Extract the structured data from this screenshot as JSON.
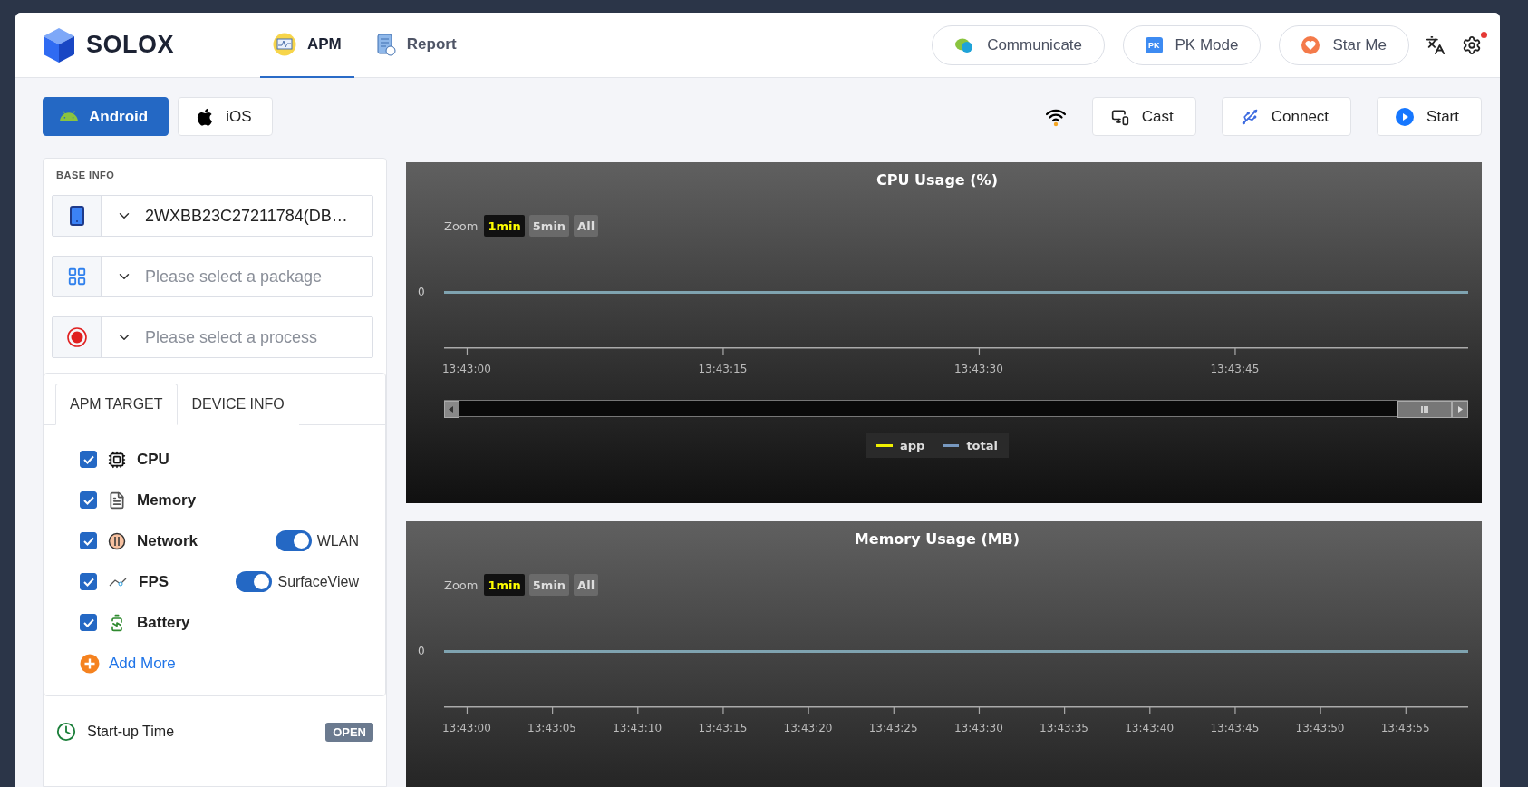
{
  "header": {
    "logo": "SOLOX",
    "tabs": [
      {
        "label": "APM",
        "selected": true
      },
      {
        "label": "Report",
        "selected": false
      }
    ],
    "actions": [
      {
        "label": "Communicate"
      },
      {
        "label": "PK Mode",
        "icon_text": "PK"
      },
      {
        "label": "Star Me"
      }
    ],
    "settings_badge": true
  },
  "platforms": [
    {
      "label": "Android",
      "selected": true
    },
    {
      "label": "iOS",
      "selected": false
    }
  ],
  "toolbar": [
    "Cast",
    "Connect",
    "Start"
  ],
  "base_info": {
    "title": "BASE INFO",
    "selects": [
      {
        "value": "2WXBB23C27211784(DB…"
      },
      {
        "placeholder": "Please select a package"
      },
      {
        "placeholder": "Please select a process"
      }
    ]
  },
  "target_tabs": [
    {
      "label": "APM TARGET",
      "selected": true
    },
    {
      "label": "DEVICE INFO",
      "selected": false
    }
  ],
  "targets": [
    {
      "label": "CPU",
      "checked": true
    },
    {
      "label": "Memory",
      "checked": true
    },
    {
      "label": "Network",
      "checked": true,
      "toggle": {
        "label": "WLAN",
        "on": true
      }
    },
    {
      "label": "FPS",
      "checked": true,
      "toggle": {
        "label": "SurfaceView",
        "on": true
      }
    },
    {
      "label": "Battery",
      "checked": true
    }
  ],
  "add_more": "Add More",
  "startup": {
    "label": "Start-up Time",
    "badge": "OPEN"
  },
  "charts": [
    {
      "title": "CPU Usage (%)",
      "zoom_label": "Zoom",
      "zoom_options": [
        {
          "label": "1min",
          "selected": true
        },
        {
          "label": "5min",
          "selected": false
        },
        {
          "label": "All",
          "selected": false
        }
      ],
      "y_tick": "0",
      "x_ticks": [
        "13:43:00",
        "13:43:15",
        "13:43:30",
        "13:43:45"
      ],
      "navigator": true,
      "legend": [
        {
          "label": "app",
          "color": "#f0f000"
        },
        {
          "label": "total",
          "color": "#7798bf"
        }
      ]
    },
    {
      "title": "Memory Usage (MB)",
      "zoom_label": "Zoom",
      "zoom_options": [
        {
          "label": "1min",
          "selected": true
        },
        {
          "label": "5min",
          "selected": false
        },
        {
          "label": "All",
          "selected": false
        }
      ],
      "y_tick": "0",
      "x_ticks": [
        "13:43:00",
        "13:43:05",
        "13:43:10",
        "13:43:15",
        "13:43:20",
        "13:43:25",
        "13:43:30",
        "13:43:35",
        "13:43:40",
        "13:43:45",
        "13:43:50",
        "13:43:55"
      ],
      "navigator": false
    }
  ]
}
